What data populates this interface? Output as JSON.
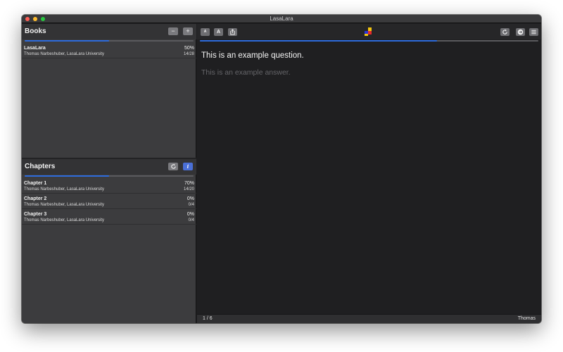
{
  "window": {
    "title": "LasaLara"
  },
  "colors": {
    "accent": "#2d6bdd",
    "info_button": "#4a6fd6",
    "logo_yellow": "#f2c40f",
    "logo_red": "#e32b2b",
    "logo_blue": "#2b36d9"
  },
  "books": {
    "title": "Books",
    "progress": 0.5,
    "items": [
      {
        "name": "LasaLara",
        "author": "Thomas Narbeshuber, LasaLara University",
        "percent": "50%",
        "count": "14/28"
      }
    ]
  },
  "chapters": {
    "title": "Chapters",
    "progress": 0.5,
    "items": [
      {
        "name": "Chapter 1",
        "author": "Thomas Narbeshuber, LasaLara University",
        "percent": "70%",
        "count": "14/20"
      },
      {
        "name": "Chapter 2",
        "author": "Thomas Narbeshuber, LasaLara University",
        "percent": "0%",
        "count": "0/4"
      },
      {
        "name": "Chapter 3",
        "author": "Thomas Narbeshuber, LasaLara University",
        "percent": "0%",
        "count": "0/4"
      }
    ]
  },
  "toolbar": {
    "font_smaller_label": "A",
    "font_larger_label": "A",
    "share_icon": "share-icon",
    "reload_icon": "reload-icon",
    "next_icon": "next-icon",
    "menu_icon": "menu-icon"
  },
  "card": {
    "progress": 0.7,
    "question": "This is an example question.",
    "answer": "This is an example answer."
  },
  "status": {
    "position": "1 / 6",
    "user": "Thomas"
  }
}
